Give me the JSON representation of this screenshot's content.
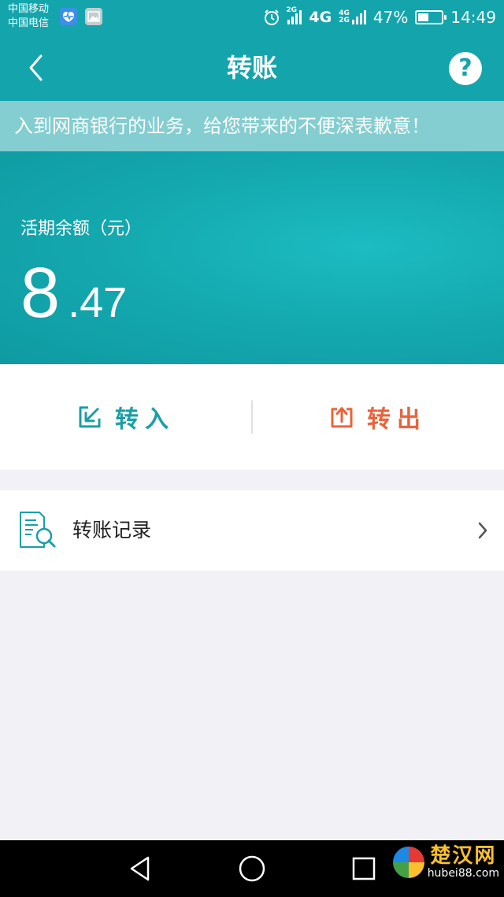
{
  "status_bar": {
    "carrier_1": "中国移动",
    "carrier_2": "中国电信",
    "net_2g": "2G",
    "net_4g": "4G",
    "net_4g_small": "4G",
    "net_2g_small": "2G",
    "battery_percent": "47%",
    "battery_level": 0.47,
    "time": "14:49",
    "icons": [
      "health-app-icon",
      "gallery-app-icon",
      "alarm-icon",
      "signal-icon",
      "battery-icon"
    ]
  },
  "header": {
    "title": "转账",
    "help_label": "?",
    "icons": [
      "chevron-left-icon",
      "help-icon"
    ]
  },
  "notice": {
    "text": "入到网商银行的业务，给您带来的不便深表歉意！"
  },
  "balance": {
    "label": "活期余额（元）",
    "amount_integer": "8",
    "amount_decimal": ".47"
  },
  "actions": {
    "transfer_in_label": "转入",
    "transfer_out_label": "转出",
    "colors": {
      "in": "#1a9fa6",
      "out": "#e8643c"
    }
  },
  "record": {
    "label": "转账记录",
    "icons": [
      "record-search-icon",
      "chevron-right-icon"
    ]
  },
  "watermark": {
    "title": "楚汉网",
    "url": "hubei88.com"
  },
  "colors": {
    "brand": "#14a5ac",
    "notice_bg": "#84cdd0",
    "page_bg": "#f2f2f6"
  }
}
